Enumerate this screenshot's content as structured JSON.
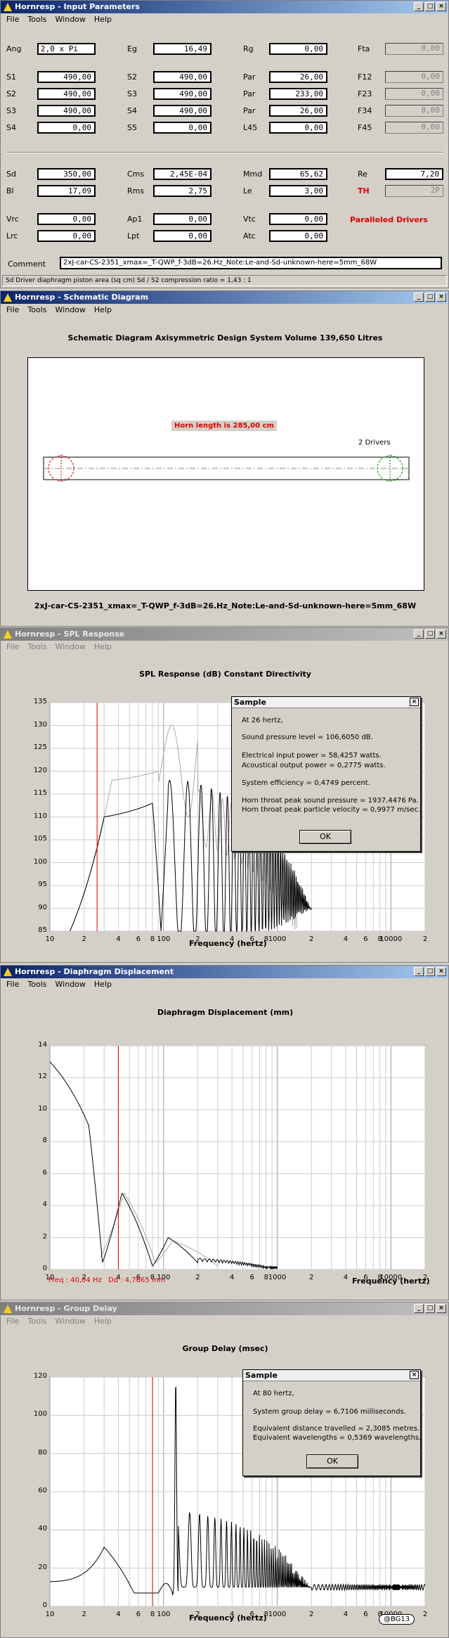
{
  "inputs": {
    "title": "Hornresp - Input Parameters",
    "menu": [
      "File",
      "Tools",
      "Window",
      "Help"
    ],
    "rows1": [
      [
        {
          "l": "Ang",
          "v": "2,0 x Pi",
          "en": true
        },
        {
          "l": "Eg",
          "v": "16,49",
          "en": true
        },
        {
          "l": "Rg",
          "v": "0,00",
          "en": true
        },
        {
          "l": "Fta",
          "v": "0,00",
          "en": false
        }
      ],
      [
        {
          "l": "S1",
          "v": "490,00",
          "en": true
        },
        {
          "l": "S2",
          "v": "490,00",
          "en": true
        },
        {
          "l": "Par",
          "v": "26,00",
          "en": true
        },
        {
          "l": "F12",
          "v": "0,00",
          "en": false
        }
      ],
      [
        {
          "l": "S2",
          "v": "490,00",
          "en": true
        },
        {
          "l": "S3",
          "v": "490,00",
          "en": true
        },
        {
          "l": "Par",
          "v": "233,00",
          "en": true
        },
        {
          "l": "F23",
          "v": "0,00",
          "en": false
        }
      ],
      [
        {
          "l": "S3",
          "v": "490,00",
          "en": true
        },
        {
          "l": "S4",
          "v": "490,00",
          "en": true
        },
        {
          "l": "Par",
          "v": "26,00",
          "en": true
        },
        {
          "l": "F34",
          "v": "0,00",
          "en": false
        }
      ],
      [
        {
          "l": "S4",
          "v": "0,00",
          "en": true
        },
        {
          "l": "S5",
          "v": "0,00",
          "en": true
        },
        {
          "l": "L45",
          "v": "0,00",
          "en": true
        },
        {
          "l": "F45",
          "v": "0,00",
          "en": false
        }
      ]
    ],
    "rows2": [
      [
        {
          "l": "Sd",
          "v": "350,00",
          "en": true
        },
        {
          "l": "Cms",
          "v": "2,45E-04",
          "en": true
        },
        {
          "l": "Mmd",
          "v": "65,62",
          "en": true
        },
        {
          "l": "Re",
          "v": "7,20",
          "en": true
        }
      ],
      [
        {
          "l": "Bl",
          "v": "17,09",
          "en": true
        },
        {
          "l": "Rms",
          "v": "2,75",
          "en": true
        },
        {
          "l": "Le",
          "v": "3,00",
          "en": true
        },
        {
          "l": "TH",
          "v": "2P",
          "en": false,
          "red": true
        }
      ]
    ],
    "rows3": [
      [
        {
          "l": "Vrc",
          "v": "0,00",
          "en": true
        },
        {
          "l": "Ap1",
          "v": "0,00",
          "en": true
        },
        {
          "l": "Vtc",
          "v": "0,00",
          "en": true
        }
      ],
      [
        {
          "l": "Lrc",
          "v": "0,00",
          "en": true
        },
        {
          "l": "Lpt",
          "v": "0,00",
          "en": true
        },
        {
          "l": "Atc",
          "v": "0,00",
          "en": true
        }
      ]
    ],
    "paralleled": "Paralleled Drivers",
    "comment_label": "Comment",
    "comment": "2xJ-car-CS-2351_xmax=_T-QWP_f-3dB=26.Hz_Note:Le-and-Sd-unknown-here=5mm_68W",
    "status": "Sd   Driver diaphragm piston area (sq cm)   Sd / S2 compression ratio = 1,43 : 1"
  },
  "schematic": {
    "title": "Hornresp - Schematic Diagram",
    "menu": [
      "File",
      "Tools",
      "Window",
      "Help"
    ],
    "header": "Schematic Diagram   Axisymmetric Design   System Volume 139,650 Litres",
    "horn_length": "Horn length is 285,00 cm",
    "drivers": "2 Drivers",
    "caption": "2xJ-car-CS-2351_xmax=_T-QWP_f-3dB=26.Hz_Note:Le-and-Sd-unknown-here=5mm_68W"
  },
  "spl": {
    "title": "Hornresp - SPL Response",
    "menu": [
      "File",
      "Tools",
      "Window",
      "Help"
    ],
    "chart_title": "SPL Response (dB)   Constant Directivity",
    "xlabel": "Frequency (hertz)",
    "yticks": [
      "135",
      "130",
      "125",
      "120",
      "115",
      "110",
      "105",
      "100",
      "95",
      "90",
      "85"
    ],
    "xticks": [
      "10",
      "2",
      "4",
      "6",
      "8",
      "100",
      "2",
      "4",
      "6",
      "8",
      "1000",
      "2",
      "4",
      "6",
      "8",
      "10000",
      "2"
    ],
    "dialog": {
      "title": "Sample",
      "lines": [
        "At 26 hertz,",
        "Sound pressure level = 106,6050 dB.",
        "Electrical input power = 58,4257 watts.",
        "Acoustical output power = 0,2775 watts.",
        "System efficiency = 0,4749 percent.",
        "Horn throat peak sound pressure = 1937,4476 Pa.",
        "Horn throat peak particle velocity = 0,9977 m/sec."
      ],
      "ok": "OK"
    }
  },
  "disp": {
    "title": "Hornresp - Diaphragm Displacement",
    "menu": [
      "File",
      "Tools",
      "Window",
      "Help"
    ],
    "chart_title": "Diaphragm Displacement (mm)",
    "xlabel": "Frequency (hertz)",
    "yticks": [
      "14",
      "12",
      "10",
      "8",
      "6",
      "4",
      "2",
      "0"
    ],
    "xticks": [
      "10",
      "2",
      "4",
      "6",
      "8",
      "100",
      "2",
      "4",
      "6",
      "8",
      "1000",
      "2",
      "4",
      "6",
      "8",
      "10000",
      "2"
    ],
    "freq": "Freq : 40,04 Hz",
    "dd": "Dd : 4,7665 mm"
  },
  "delay": {
    "title": "Hornresp - Group Delay",
    "menu": [
      "File",
      "Tools",
      "Window",
      "Help"
    ],
    "chart_title": "Group Delay (msec)",
    "xlabel": "Frequency (hertz)",
    "yticks": [
      "120",
      "100",
      "80",
      "60",
      "40",
      "20",
      "0"
    ],
    "xticks": [
      "10",
      "2",
      "4",
      "6",
      "8",
      "100",
      "2",
      "4",
      "6",
      "8",
      "1000",
      "2",
      "4",
      "6",
      "8",
      "10000",
      "2"
    ],
    "dialog": {
      "title": "Sample",
      "lines": [
        "At 80 hertz,",
        "System group delay = 6,7106 milliseconds.",
        "Equivalent distance travelled = 2,3085 metres.",
        "Equivalent wavelengths = 0,5369 wavelengths."
      ],
      "ok": "OK"
    },
    "badge": "@BG13"
  },
  "chart_data": [
    {
      "type": "line",
      "title": "SPL Response (dB)   Constant Directivity",
      "xlabel": "Frequency (hertz)",
      "xscale": "log",
      "xlim": [
        10,
        20000
      ],
      "ylim": [
        85,
        135
      ],
      "marker_hz": 26,
      "series": [
        {
          "values_hz": [
            10,
            15,
            20,
            25,
            30,
            40,
            60,
            80,
            100,
            120,
            150,
            200,
            300
          ],
          "values_db": [
            85,
            95,
            105,
            109,
            110,
            111,
            112,
            113,
            85,
            120,
            110,
            125,
            90
          ]
        }
      ]
    },
    {
      "type": "line",
      "title": "Diaphragm Displacement (mm)",
      "xlabel": "Frequency (hertz)",
      "xscale": "log",
      "xlim": [
        10,
        20000
      ],
      "ylim": [
        0,
        14
      ],
      "marker_hz": 40.04,
      "series": [
        {
          "x": [
            10,
            15,
            20,
            25,
            30,
            40,
            50,
            70,
            80,
            100,
            120,
            150,
            200,
            300,
            500
          ],
          "y": [
            13,
            12,
            8,
            1.5,
            0.5,
            4.5,
            4.7,
            3,
            0.5,
            1.5,
            2,
            1,
            0.7,
            0.3,
            0.1
          ]
        }
      ]
    },
    {
      "type": "line",
      "title": "Group Delay (msec)",
      "xlabel": "Frequency (hertz)",
      "xscale": "log",
      "xlim": [
        10,
        20000
      ],
      "ylim": [
        0,
        120
      ],
      "marker_hz": 80,
      "series": [
        {
          "x": [
            10,
            20,
            30,
            50,
            80,
            100,
            120,
            130,
            150,
            200,
            300,
            500,
            1000,
            20000
          ],
          "y": [
            13,
            22,
            31,
            13,
            7,
            12,
            8,
            112,
            20,
            30,
            25,
            15,
            10,
            10
          ]
        }
      ]
    }
  ]
}
